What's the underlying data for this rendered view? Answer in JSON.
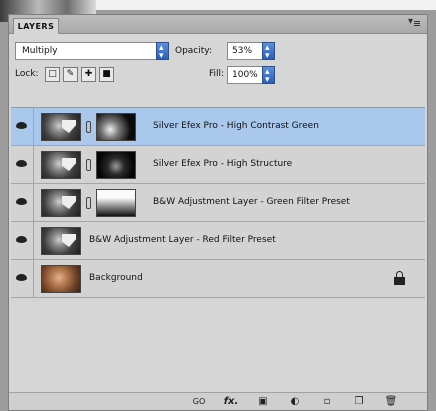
{
  "panel": {
    "tab_label": "LAYERS",
    "blend_mode": "Multiply",
    "opacity_label": "Opacity:",
    "opacity_value": "53%",
    "lock_label": "Lock:",
    "fill_label": "Fill:",
    "fill_value": "100%"
  },
  "layers": [
    {
      "name": "Silver Efex Pro - High Contrast Green",
      "selected": true
    },
    {
      "name": "Silver Efex Pro - High Structure",
      "selected": false
    },
    {
      "name": "B&W Adjustment Layer - Green Filter Preset",
      "selected": false
    },
    {
      "name": "B&W Adjustment Layer - Red Filter Preset",
      "selected": false
    },
    {
      "name": "Background",
      "selected": false
    }
  ],
  "bottom": {
    "link_label": "GO",
    "fx_label": "fx."
  },
  "colors": {
    "selected_row": "#a9c8ec",
    "panel": "#d6d6d6",
    "spin_accent": "#2c5fb5"
  }
}
